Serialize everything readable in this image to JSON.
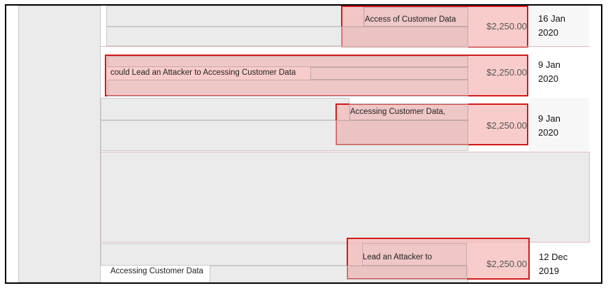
{
  "rows": [
    {
      "fragment": "Access of Customer Data",
      "amount": "$2,250.00",
      "date_line1": "16 Jan",
      "date_line2": "2020"
    },
    {
      "fragment": "could Lead an Attacker to Accessing Customer Data",
      "amount": "$2,250.00",
      "date_line1": "9 Jan",
      "date_line2": "2020"
    },
    {
      "fragment": "Accessing Customer Data,",
      "amount": "$2,250.00",
      "date_line1": "9 Jan",
      "date_line2": "2020"
    },
    {
      "fragment": "Lead an Attacker to",
      "amount": "$2,250.00",
      "date_line1": "12 Dec",
      "date_line2": "2019"
    }
  ],
  "bottom_fragment": "Accessing Customer Data",
  "colors": {
    "highlight_border": "#d01a1a",
    "highlight_fill": "#f7b7b7",
    "panel_gray": "#ebebeb"
  }
}
